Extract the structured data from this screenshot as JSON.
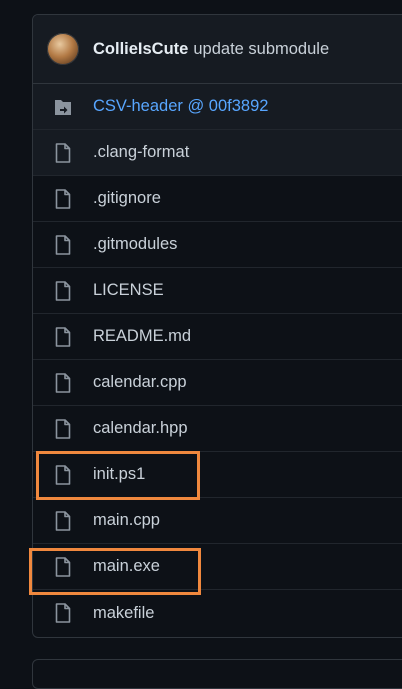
{
  "commit": {
    "author": "CollieIsCute",
    "message": "update submodule"
  },
  "files": [
    {
      "name": "CSV-header @ 00f3892",
      "type": "submodule",
      "icon": "submodule-folder-icon"
    },
    {
      "name": ".clang-format",
      "type": "file",
      "icon": "file-icon"
    },
    {
      "name": ".gitignore",
      "type": "file",
      "icon": "file-icon"
    },
    {
      "name": ".gitmodules",
      "type": "file",
      "icon": "file-icon"
    },
    {
      "name": "LICENSE",
      "type": "file",
      "icon": "file-icon"
    },
    {
      "name": "README.md",
      "type": "file",
      "icon": "file-icon"
    },
    {
      "name": "calendar.cpp",
      "type": "file",
      "icon": "file-icon"
    },
    {
      "name": "calendar.hpp",
      "type": "file",
      "icon": "file-icon"
    },
    {
      "name": "init.ps1",
      "type": "file",
      "icon": "file-icon"
    },
    {
      "name": "main.cpp",
      "type": "file",
      "icon": "file-icon"
    },
    {
      "name": "main.exe",
      "type": "file",
      "icon": "file-icon"
    },
    {
      "name": "makefile",
      "type": "file",
      "icon": "file-icon"
    }
  ],
  "colors": {
    "background": "#0d1117",
    "header": "#161b22",
    "border": "#30363d",
    "link": "#58a6ff",
    "text": "#c9d1d9",
    "highlight": "#f0883e"
  }
}
